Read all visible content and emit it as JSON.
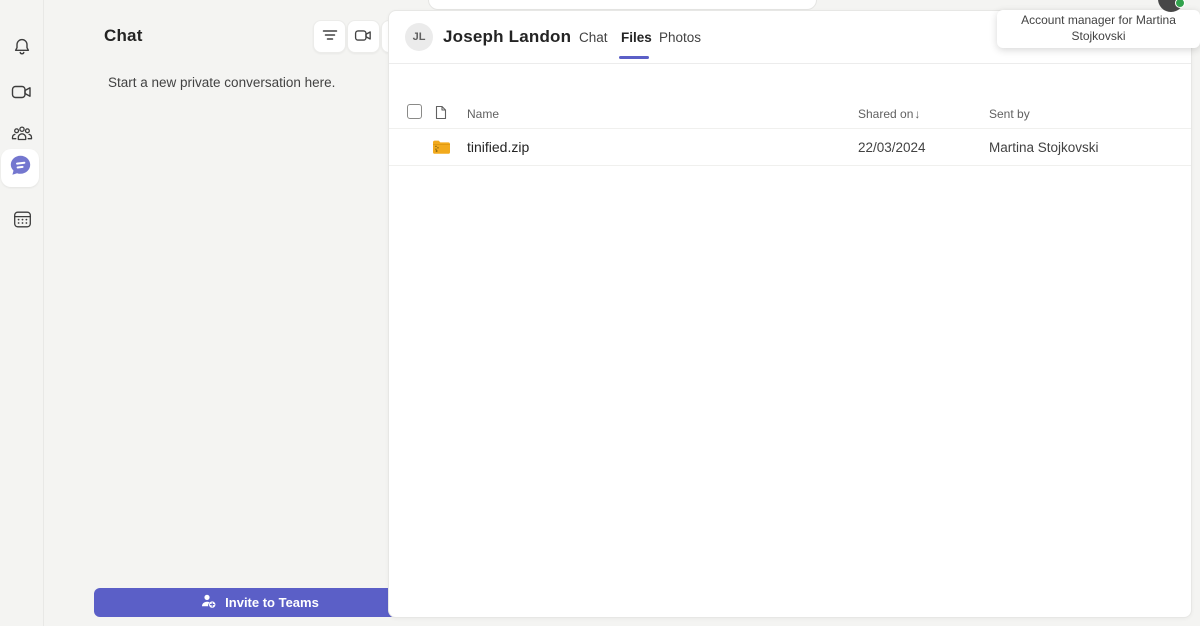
{
  "colors": {
    "accent": "#5b5fc7",
    "presence": "#31a24c",
    "zip_folder": "#f2aa1d"
  },
  "rail": {
    "items": [
      {
        "name": "activity",
        "icon": "bell-icon"
      },
      {
        "name": "meet",
        "icon": "video-camera-icon"
      },
      {
        "name": "community",
        "icon": "people-icon"
      },
      {
        "name": "chat",
        "icon": "chat-bubble-icon",
        "active": true
      },
      {
        "name": "calendar",
        "icon": "calendar-icon"
      }
    ]
  },
  "chat_panel": {
    "title": "Chat",
    "empty_state": "Start a new private conversation here.",
    "invite_button_label": "Invite to Teams"
  },
  "conversation": {
    "avatar_initials": "JL",
    "title": "Joseph Landon",
    "tabs": [
      {
        "label": "Chat",
        "active": false
      },
      {
        "label": "Files",
        "active": true
      },
      {
        "label": "Photos",
        "active": false
      }
    ]
  },
  "files_table": {
    "columns": {
      "name": "Name",
      "shared_on": "Shared on",
      "sent_by": "Sent by"
    },
    "sort_icon": "↓",
    "rows": [
      {
        "icon": "zip-folder-icon",
        "name": "tinified.zip",
        "shared_on": "22/03/2024",
        "sent_by": "Martina Stojkovski"
      }
    ]
  },
  "tooltip": {
    "text": "Account manager for Martina Stojkovski"
  }
}
